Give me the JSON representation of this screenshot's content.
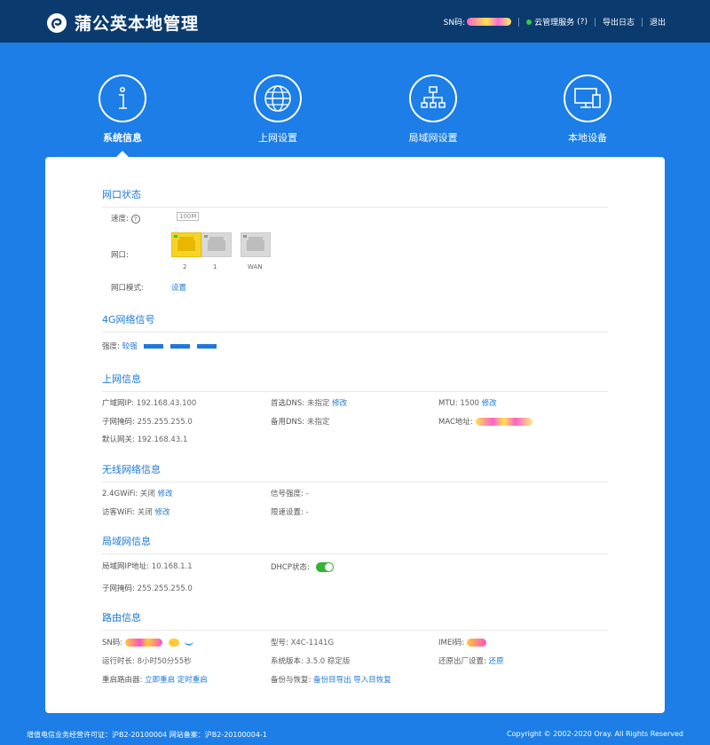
{
  "header": {
    "title": "蒲公英本地管理",
    "sn_label": "SN码:",
    "cloud_service": "云管理服务",
    "help": "(?)",
    "export_log": "导出日志",
    "logout": "退出"
  },
  "nav": {
    "items": [
      {
        "label": "系统信息",
        "icon": "info-icon",
        "active": true
      },
      {
        "label": "上网设置",
        "icon": "globe-icon"
      },
      {
        "label": "局域网设置",
        "icon": "network-icon"
      },
      {
        "label": "本地设备",
        "icon": "devices-icon"
      }
    ]
  },
  "port_status": {
    "title": "网口状态",
    "speed_label": "速度:",
    "speed_help": "?",
    "speed_badge": "100M",
    "port_label": "网口:",
    "ports": [
      "2",
      "1",
      "WAN"
    ],
    "mode_label": "网口模式:",
    "mode_link": "设置"
  },
  "signal": {
    "title": "4G网络信号",
    "strength_label": "强度:",
    "strength_value": "较强",
    "bars": 3
  },
  "internet": {
    "title": "上网信息",
    "wan_ip_label": "广域网IP:",
    "wan_ip": "192.168.43.100",
    "subnet_label": "子网掩码:",
    "subnet": "255.255.255.0",
    "gateway_label": "默认网关:",
    "gateway": "192.168.43.1",
    "dns1_label": "首选DNS:",
    "dns1": "未指定",
    "dns1_edit": "修改",
    "dns2_label": "备用DNS:",
    "dns2": "未指定",
    "mtu_label": "MTU:",
    "mtu": "1500",
    "mtu_edit": "修改",
    "mac_label": "MAC地址:"
  },
  "wireless": {
    "title": "无线网络信息",
    "wifi24_label": "2.4GWiFi:",
    "wifi24": "关闭",
    "wifi24_edit": "修改",
    "guest_label": "访客WiFi:",
    "guest": "关闭",
    "guest_edit": "修改",
    "signal_label": "信号强度:",
    "signal": "-",
    "limit_label": "限速设置:",
    "limit": "-"
  },
  "lan": {
    "title": "局域网信息",
    "ip_label": "局域网IP地址:",
    "ip": "10.168.1.1",
    "subnet_label": "子网掩码:",
    "subnet": "255.255.255.0",
    "dhcp_label": "DHCP状态:",
    "dhcp_on": true
  },
  "router": {
    "title": "路由信息",
    "sn_label": "SN码:",
    "model_label": "型号:",
    "model": "X4C-1141G",
    "imei_label": "IMEI码:",
    "uptime_label": "运行时长:",
    "uptime": "8小时50分55秒",
    "version_label": "系统版本:",
    "version": "3.5.0 稳定版",
    "factory_label": "还原出厂设置:",
    "factory_link": "还原",
    "reboot_label": "重启路由器:",
    "reboot_now": "立即重启",
    "reboot_timer": "定时重启",
    "backup_label": "备份与恢复:",
    "backup_export": "备份目导出",
    "backup_import": "导入目恢复"
  },
  "footer": {
    "license": "增值电信业务经营许可证：沪B2-20100004 网站备案：沪B2-20100004-1",
    "copyright": "Copyright © 2002-2020 Oray. All Rights Reserved"
  }
}
